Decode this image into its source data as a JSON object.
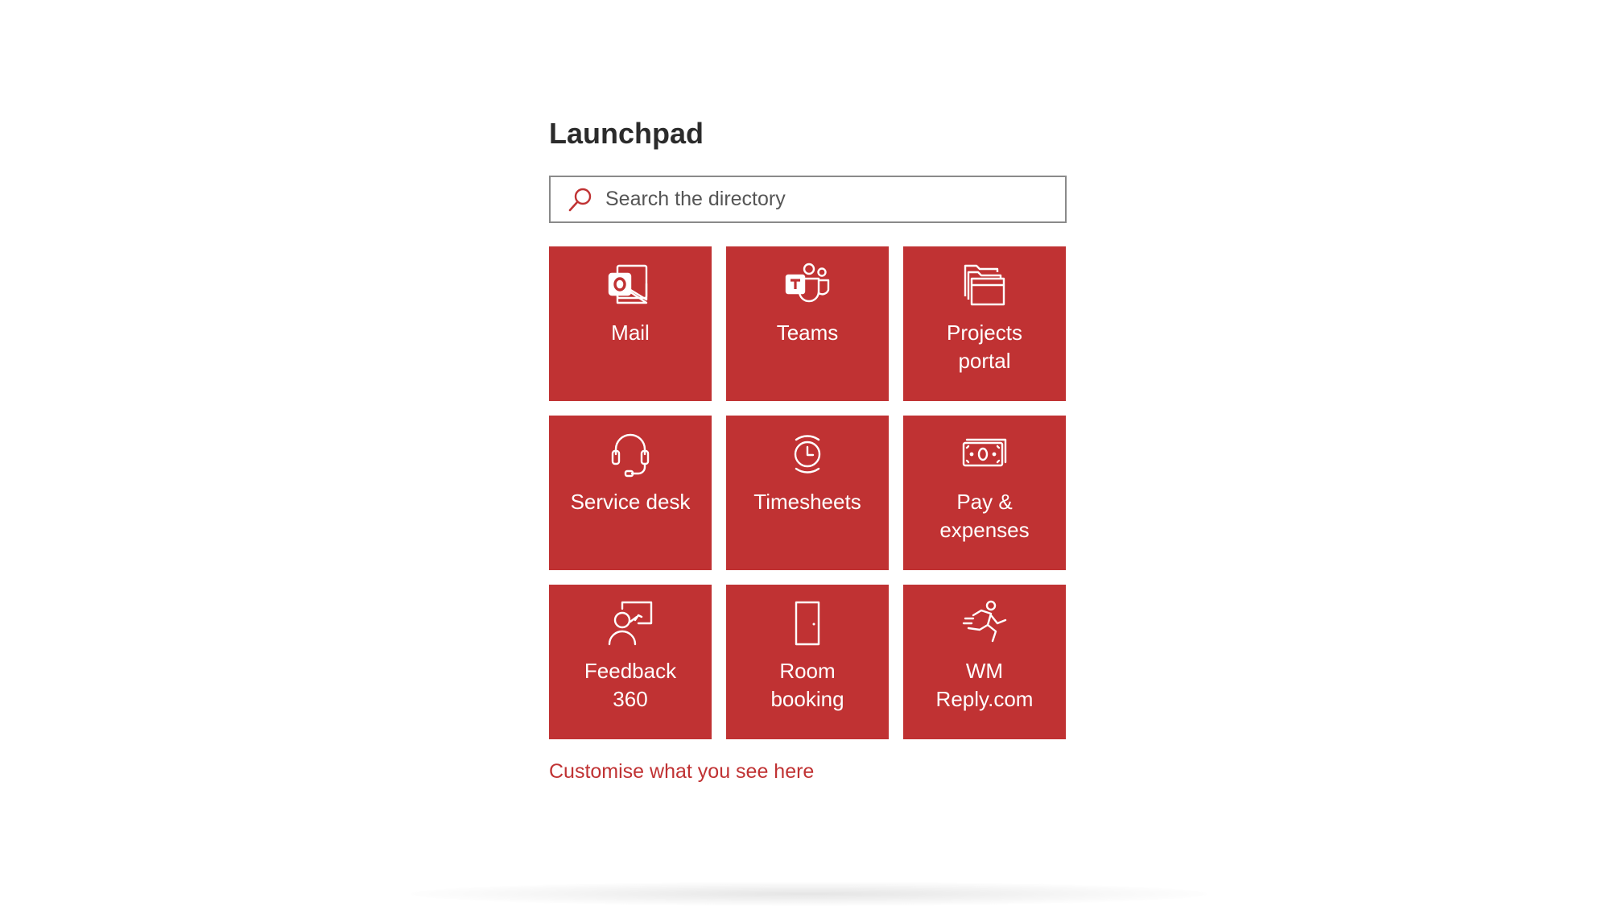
{
  "page": {
    "title": "Launchpad"
  },
  "search": {
    "placeholder": "Search the directory",
    "value": "",
    "icon": "search-icon"
  },
  "tiles": [
    {
      "label": "Mail",
      "icon": "outlook-mail-icon"
    },
    {
      "label": "Teams",
      "icon": "teams-icon"
    },
    {
      "label": "Projects\nportal",
      "icon": "folder-icon"
    },
    {
      "label": "Service desk",
      "icon": "headset-icon"
    },
    {
      "label": "Timesheets",
      "icon": "clock-icon"
    },
    {
      "label": "Pay &\nexpenses",
      "icon": "money-icon"
    },
    {
      "label": "Feedback\n360",
      "icon": "feedback-person-icon"
    },
    {
      "label": "Room\nbooking",
      "icon": "door-icon"
    },
    {
      "label": "WM\nReply.com",
      "icon": "running-person-icon"
    }
  ],
  "footer": {
    "customise_label": "Customise what you see here"
  },
  "colors": {
    "tile_background": "#c03233",
    "tile_text": "#ffffff",
    "link": "#c03233",
    "title": "#2b2b2b",
    "search_border": "#8a8a8a"
  }
}
